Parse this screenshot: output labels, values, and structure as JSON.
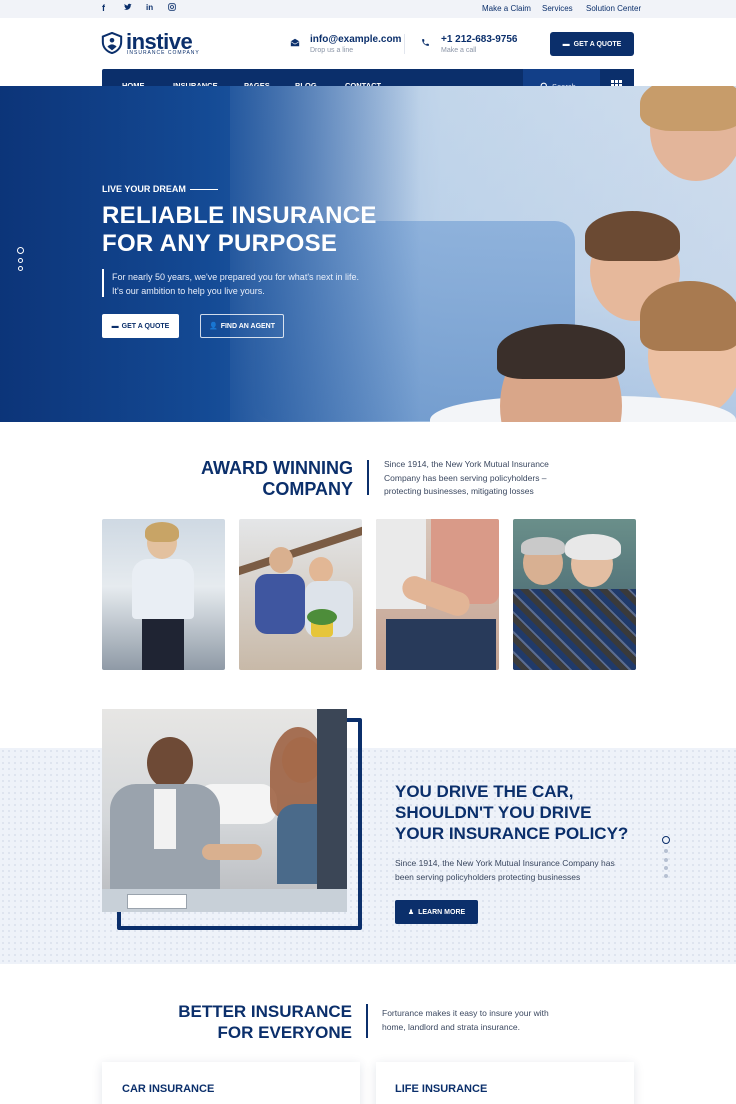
{
  "topbar": {
    "social": [
      {
        "icon": "facebook-icon",
        "glyph": "f"
      },
      {
        "icon": "twitter-icon",
        "glyph": "🐦"
      },
      {
        "icon": "linkedin-icon",
        "glyph": "in"
      },
      {
        "icon": "instagram-icon",
        "glyph": "◎"
      }
    ],
    "links": [
      "Make a Claim",
      "Services",
      "Solution Center"
    ]
  },
  "header": {
    "logo_text": "instive",
    "logo_sub": "INSURANCE COMPANY",
    "email": {
      "value": "info@example.com",
      "sub": "Drop us a line"
    },
    "phone": {
      "value": "+1 212-683-9756",
      "sub": "Make a call"
    },
    "quote_button": "GET A QUOTE"
  },
  "nav": {
    "items": [
      "HOME",
      "INSURANCE",
      "PAGES",
      "BLOG",
      "CONTACT"
    ],
    "search_placeholder": "Search..."
  },
  "hero": {
    "eyebrow": "LIVE YOUR DREAM",
    "title_line1": "RELIABLE INSURANCE",
    "title_line2": "FOR ANY PURPOSE",
    "description": "For nearly 50 years, we've prepared you for what's next in life. It's our ambition to help you live yours.",
    "btn_quote": "GET A QUOTE",
    "btn_agent": "FIND AN AGENT"
  },
  "award": {
    "title_line1": "AWARD WINNING",
    "title_line2": "COMPANY",
    "text": "Since 1914, the New York Mutual Insurance Company has been serving policyholders – protecting businesses, mitigating losses"
  },
  "drive": {
    "title_line1": "YOU DRIVE THE CAR,",
    "title_line2": "SHOULDN'T YOU DRIVE",
    "title_line3": "YOUR INSURANCE POLICY?",
    "text": "Since 1914, the New York Mutual Insurance Company has been serving policyholders protecting businesses",
    "button": "LEARN MORE"
  },
  "better": {
    "title_line1": "BETTER INSURANCE",
    "title_line2": "FOR EVERYONE",
    "text": "Forturance makes it easy to insure your with home, landlord and strata insurance."
  },
  "cards": [
    "CAR INSURANCE",
    "LIFE INSURANCE"
  ],
  "colors": {
    "primary": "#0b2f6b",
    "accent": "#123f88"
  }
}
